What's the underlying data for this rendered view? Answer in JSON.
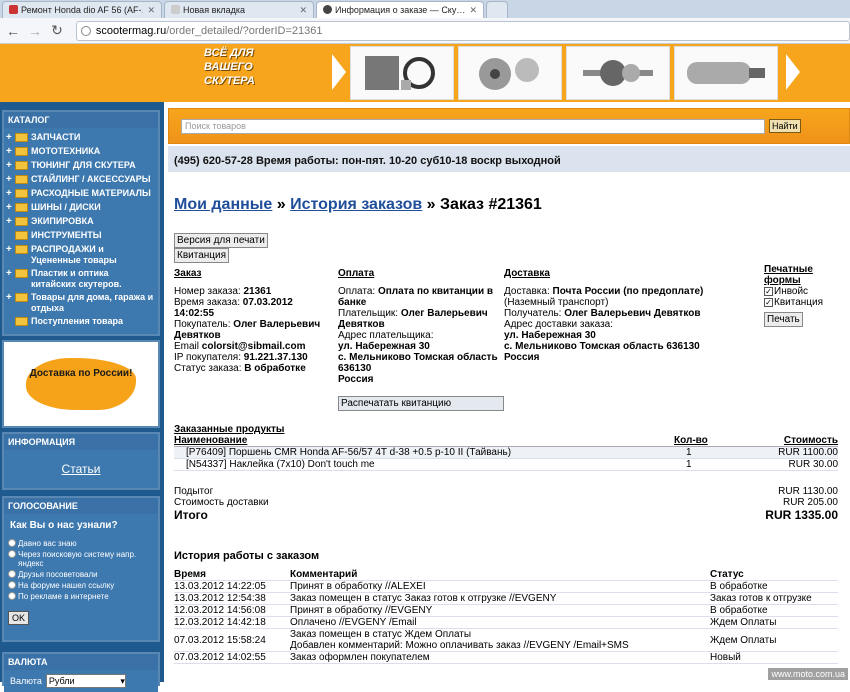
{
  "browser": {
    "tabs": [
      {
        "label": "Ремонт Honda dio AF 56 (AF-…",
        "active": false
      },
      {
        "label": "Новая вкладка",
        "active": false
      },
      {
        "label": "Информация о заказе — Ску…",
        "active": true
      }
    ],
    "url_host": "scootermag.ru",
    "url_path": "/order_detailed/?orderID=21361"
  },
  "banner": {
    "slogan_lines": [
      "ВСЁ ДЛЯ",
      "ВАШЕГО",
      "СКУТЕРА"
    ],
    "accent_color": "#f7a51c"
  },
  "sidebar": {
    "catalog": {
      "title": "КАТАЛОГ",
      "items": [
        {
          "label": "ЗАПЧАСТИ",
          "expandable": true
        },
        {
          "label": "МОТОТЕХНИКА",
          "expandable": true
        },
        {
          "label": "ТЮНИНГ для скутера",
          "expandable": true
        },
        {
          "label": "СТАЙЛИНГ / АКСЕССУАРЫ",
          "expandable": true
        },
        {
          "label": "РАСХОДНЫЕ МАТЕРИАЛЫ",
          "expandable": true
        },
        {
          "label": "ШИНЫ / ДИСКИ",
          "expandable": true
        },
        {
          "label": "ЭКИПИРОВКА",
          "expandable": true
        },
        {
          "label": "ИНСТРУМЕНТЫ",
          "expandable": false
        },
        {
          "label": "РАСПРОДАЖИ и Уцененные товары",
          "expandable": true
        },
        {
          "label": "Пластик и оптика китайских скутеров.",
          "expandable": true
        },
        {
          "label": "Товары для дома, гаража и отдыха",
          "expandable": true
        },
        {
          "label": "Поступления товара",
          "expandable": false
        }
      ]
    },
    "promo": {
      "text": "Доставка по России!"
    },
    "info": {
      "title": "ИНФОРМАЦИЯ",
      "link": "Статьи"
    },
    "vote": {
      "title": "ГОЛОСОВАНИЕ",
      "question": "Как Вы о нас узнали?",
      "options": [
        "Давно вас знаю",
        "Через поисковую систему напр. яндекс",
        "Друзья посоветовали",
        "На форуме нашел ссылку",
        "По рекламе в интернете"
      ],
      "ok": "OK"
    },
    "currency": {
      "title": "ВАЛЮТА",
      "label": "Валюта",
      "selected": "Рубли"
    }
  },
  "search": {
    "placeholder": "Поиск товаров",
    "button": "Найти"
  },
  "phone_line": "(495) 620-57-28 Время работы: пон-пят. 10-20 суб10-18 воскр выходной",
  "breadcrumb": {
    "my_data": "Мои данные",
    "sep": " » ",
    "history": "История заказов",
    "order": "Заказ #21361"
  },
  "buttons": {
    "print_version": "Версия для печати",
    "receipt": "Квитанция",
    "print_receipt": "Распечатать квитанцию",
    "print": "Печать"
  },
  "order": {
    "title": "Заказ",
    "number_label": "Номер заказа:",
    "number": "21361",
    "time_label": "Время заказа:",
    "time": "07.03.2012 14:02:55",
    "buyer_label": "Покупатель:",
    "buyer": "Олег Валерьевич Девятков",
    "email_label": "Email",
    "email": "colorsit@sibmail.com",
    "ip_label": "IP покупателя:",
    "ip": "91.221.37.130",
    "status_label": "Статус заказа:",
    "status": "В обработке"
  },
  "payment": {
    "title": "Оплата",
    "method_label": "Оплата:",
    "method": "Оплата по квитанции в банке",
    "payer_label": "Плательщик:",
    "payer": "Олег Валерьевич Девятков",
    "address_label": "Адрес плательщика:",
    "address_lines": [
      "ул. Набережная 30",
      "с. Мельниково Томская область 636130",
      "Россия"
    ]
  },
  "delivery": {
    "title": "Доставка",
    "method_label": "Доставка:",
    "method": "Почта России (по предоплате)",
    "method_note": "(Наземный транспорт)",
    "recipient_label": "Получатель:",
    "recipient": "Олег Валерьевич Девятков",
    "address_label": "Адрес доставки заказа:",
    "address_lines": [
      "ул. Набережная 30",
      "с. Мельниково Томская область 636130",
      "Россия"
    ]
  },
  "print_forms": {
    "title": "Печатные формы",
    "invoice": "Инвойс",
    "receipt": "Квитанция"
  },
  "products": {
    "title": "Заказанные продукты",
    "headers": {
      "name": "Наименование",
      "qty": "Кол-во",
      "cost": "Стоимость"
    },
    "rows": [
      {
        "name": "[P76409] Поршень CMR Honda AF-56/57 4T d-38 +0.5 p-10 II (Тайвань)",
        "qty": "1",
        "cost": "RUR 1100.00"
      },
      {
        "name": "[N54337] Наклейка (7x10) Don't touch me",
        "qty": "1",
        "cost": "RUR 30.00"
      }
    ]
  },
  "totals": {
    "subtotal_label": "Подытог",
    "subtotal": "RUR 1130.00",
    "shipping_label": "Стоимость доставки",
    "shipping": "RUR 205.00",
    "total_label": "Итого",
    "total": "RUR 1335.00"
  },
  "history": {
    "title": "История работы с заказом",
    "headers": {
      "time": "Время",
      "comment": "Комментарий",
      "status": "Статус"
    },
    "rows": [
      {
        "time": "13.03.2012 14:22:05",
        "comment": "Принят в обработку //ALEXEI",
        "comment2": "",
        "status": "В обработке"
      },
      {
        "time": "13.03.2012 12:54:38",
        "comment": "Заказ помещен в статус Заказ готов к отгрузке //EVGENY",
        "comment2": "",
        "status": "Заказ готов к отгрузке"
      },
      {
        "time": "12.03.2012 14:56:08",
        "comment": "Принят в обработку //EVGENY",
        "comment2": "",
        "status": "В обработке"
      },
      {
        "time": "12.03.2012 14:42:18",
        "comment": "Оплачено //EVGENY /Email",
        "comment2": "",
        "status": "Ждем Оплаты"
      },
      {
        "time": "07.03.2012 15:58:24",
        "comment": "Заказ помещен в статус Ждем Оплаты",
        "comment2": "Добавлен комментарий: Можно оплачивать заказ //EVGENY /Email+SMS",
        "status": "Ждем Оплаты"
      },
      {
        "time": "07.03.2012 14:02:55",
        "comment": "Заказ оформлен покупателем",
        "comment2": "",
        "status": "Новый"
      }
    ]
  },
  "watermark": "www.moto.com.ua"
}
